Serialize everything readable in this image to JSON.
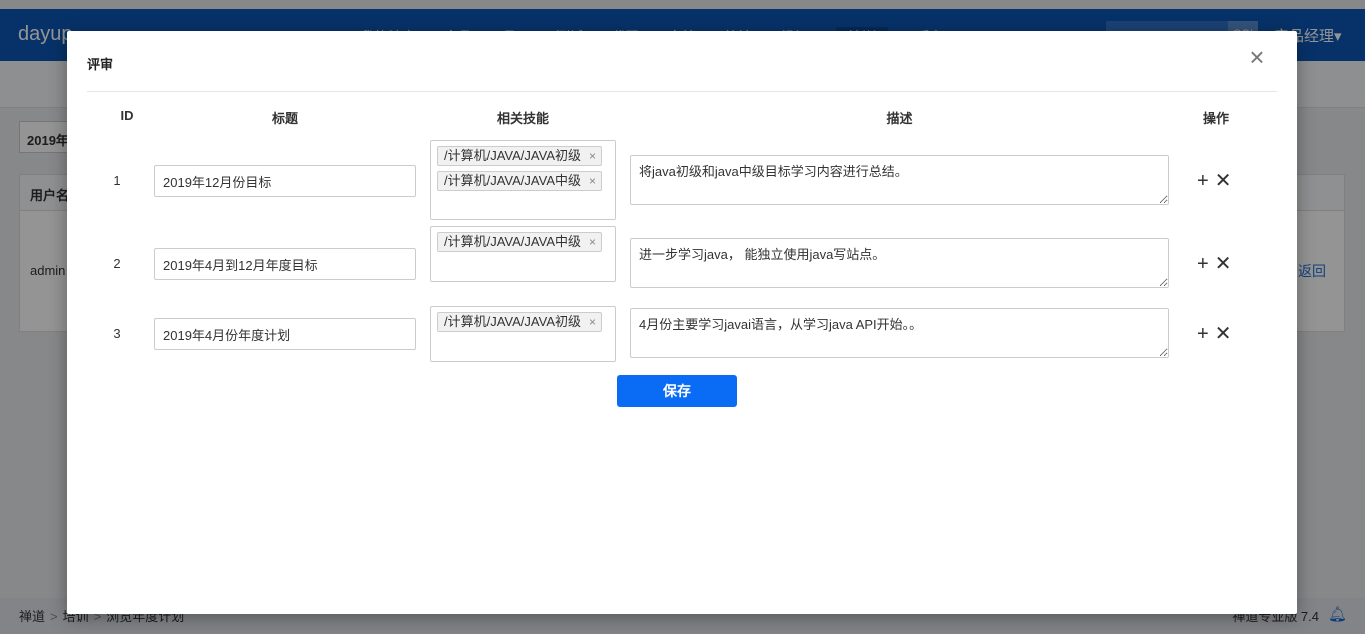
{
  "app": {
    "brand": "dayup",
    "nav_items": [
      "我的地盘",
      "产品",
      "项目",
      "测试",
      "代码",
      "文档",
      "统计",
      "组织",
      "培训",
      "后台"
    ],
    "search_button": "GO!",
    "user_menu": "产品经理▾"
  },
  "background": {
    "year_chip": "2019年",
    "table_header_user": "用户名",
    "row_user": "admin",
    "row_link": "返回"
  },
  "footer": {
    "crumbs": [
      "禅道",
      "培训",
      "浏览年度计划"
    ],
    "version": "禅道专业版 7.4",
    "bell_icon": "bell-icon"
  },
  "modal": {
    "title": "评审",
    "close_icon": "×",
    "columns": {
      "id": "ID",
      "title": "标题",
      "skills": "相关技能",
      "desc": "描述",
      "ops": "操作"
    },
    "rows": [
      {
        "id": "1",
        "title": "2019年12月份目标",
        "skills": [
          "/计算机/JAVA/JAVA初级",
          "/计算机/JAVA/JAVA中级"
        ],
        "desc": "将java初级和java中级目标学习内容进行总结。"
      },
      {
        "id": "2",
        "title": "2019年4月到12月年度目标",
        "skills": [
          "/计算机/JAVA/JAVA中级"
        ],
        "desc": "进一步学习java， 能独立使用java写站点。"
      },
      {
        "id": "3",
        "title": "2019年4月份年度计划",
        "skills": [
          "/计算机/JAVA/JAVA初级"
        ],
        "desc": "4月份主要学习javai语言，从学习java API开始。。"
      }
    ],
    "tag_remove": "×",
    "add_icon": "+",
    "remove_icon": "✕",
    "save_label": "保存"
  }
}
